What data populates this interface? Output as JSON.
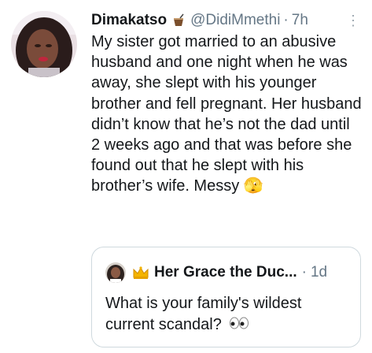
{
  "tweet": {
    "author_name": "Dimakatso",
    "author_emoji": "drink-cup-icon",
    "handle": "@DidiMmethi",
    "separator": "·",
    "time": "7h",
    "more_label": "⋮",
    "text": "My sister got married to an abusive husband and one night when he was away, she slept with his younger brother and fell pregnant. Her husband didn’t know that he’s not the dad until 2 weeks ago and that was before she found out that he slept with his brother’s wife. Messy 🫣"
  },
  "quoted_tweet": {
    "author_name": "Her Grace the Duc...",
    "author_emoji": "crown-icon",
    "separator": "·",
    "time": "1d",
    "text": "What is your family's wildest current scandal?",
    "trailing_emoji": "eyes-icon"
  }
}
